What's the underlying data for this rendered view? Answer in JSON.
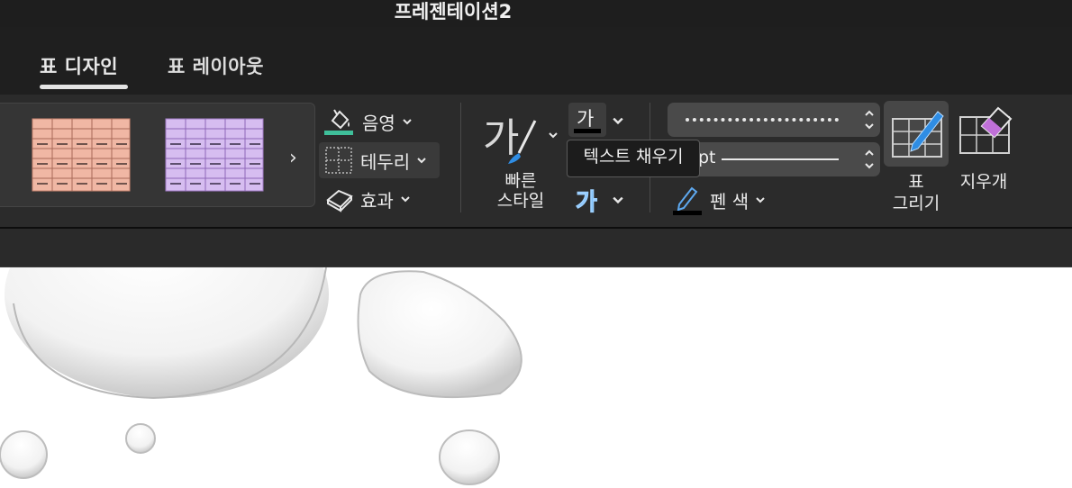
{
  "window": {
    "title": "프레젠테이션2"
  },
  "tabs": [
    {
      "label": "표 디자인",
      "active": true
    },
    {
      "label": "표 레이아웃",
      "active": false
    }
  ],
  "ribbon": {
    "table_styles": {
      "thumbnails": [
        {
          "name": "salmon-table-style",
          "fill": "#f0b7a4",
          "lines": "#c98470"
        },
        {
          "name": "lavender-table-style",
          "fill": "#d6bdf0",
          "lines": "#a37cc9"
        }
      ]
    },
    "shading_label": "음영",
    "borders_label": "테두리",
    "effects_label": "효과",
    "quick_styles_label_line1": "빠른",
    "quick_styles_label_line2": "스타일",
    "text_fill_glyph": "가",
    "text_outline_glyph": "가",
    "tooltip": "텍스트 채우기",
    "pen_weight_text": "pt",
    "pen_color_label": "펜 색",
    "draw_table_line1": "표",
    "draw_table_line2": "그리기",
    "eraser_label": "지우개"
  },
  "colors": {
    "shading_accent": "#3fbf9a",
    "text_outline_accent": "#2f8de4",
    "eraser_accent": "#c070d8"
  }
}
